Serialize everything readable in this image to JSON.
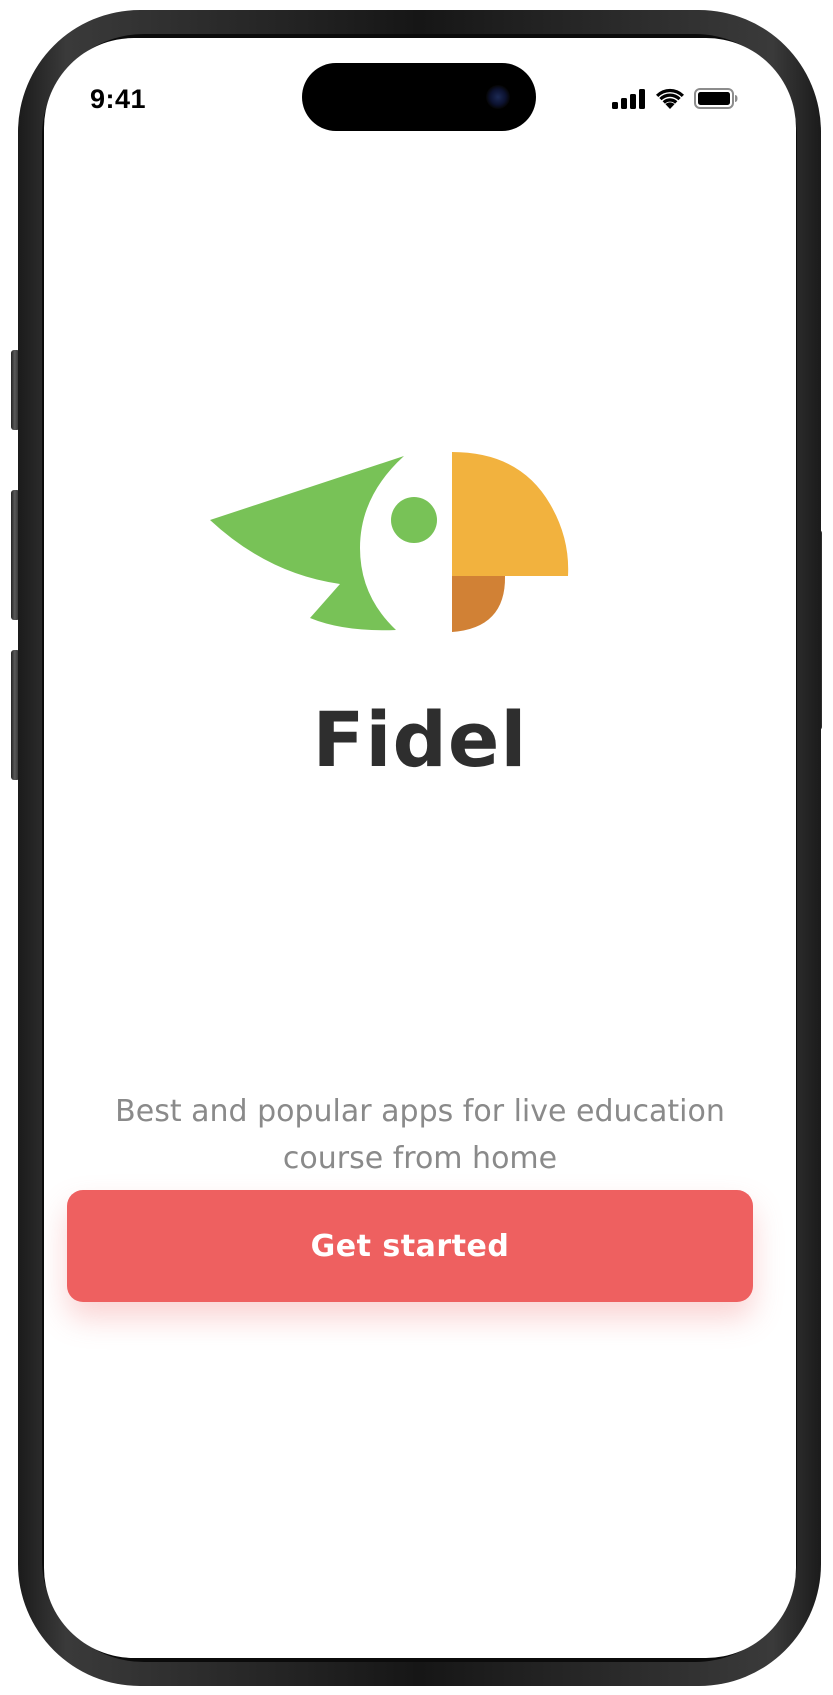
{
  "status_bar": {
    "time": "9:41",
    "icons": [
      "cellular-signal-icon",
      "wifi-icon",
      "battery-icon"
    ]
  },
  "logo": {
    "icon": "parrot-logo-icon",
    "colors": {
      "green": "#78c257",
      "yellow": "#f2b23e",
      "orange": "#d18135"
    }
  },
  "app": {
    "name": "Fidel",
    "tagline_line1": "Best and popular apps for live education",
    "tagline_line2": "course from home"
  },
  "actions": {
    "get_started_label": "Get started"
  },
  "theme": {
    "accent": "#ee6060",
    "title_color": "#2e2e2e",
    "tagline_color": "#8a8a8a"
  }
}
